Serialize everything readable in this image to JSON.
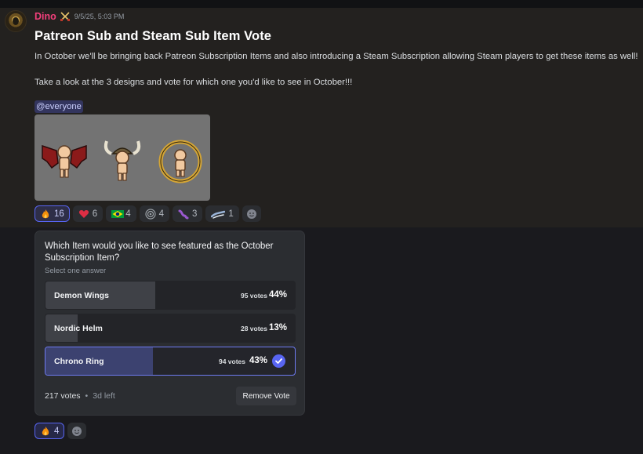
{
  "message": {
    "username": "Dino",
    "username_color": "#f23f7b",
    "role_icon": "crossed-swords-icon",
    "timestamp": "9/5/25, 5:03 PM",
    "title": "Patreon Sub and Steam Sub Item Vote",
    "paragraph1": "In October we'll be bringing back Patreon Subscription Items and also introducing a Steam Subscription allowing Steam players to get these items as well!",
    "paragraph2": "Take a look at the 3 designs and vote for which one you'd like to see in October!!!",
    "mention": "@everyone",
    "attachment_sprites": [
      "demon-wings-sprite",
      "nordic-helm-sprite",
      "chrono-ring-sprite"
    ]
  },
  "reactions": [
    {
      "icon": "fire-emoji",
      "count": "16",
      "me": true
    },
    {
      "icon": "red-heart-emoji",
      "count": "6",
      "me": false
    },
    {
      "icon": "brazil-flag-emoji",
      "count": "4",
      "me": false
    },
    {
      "icon": "target-emoji",
      "count": "4",
      "me": false
    },
    {
      "icon": "purple-worm-emoji",
      "count": "3",
      "me": false
    },
    {
      "icon": "wave-emoji",
      "count": "1",
      "me": false
    }
  ],
  "poll": {
    "question": "Which Item would you like to see featured as the October Subscription Item?",
    "hint": "Select one answer",
    "answers": [
      {
        "label": "Demon Wings",
        "votes": "95 votes",
        "percent": "44%",
        "fraction": 0.44,
        "voted": false
      },
      {
        "label": "Nordic Helm",
        "votes": "28 votes",
        "percent": "13%",
        "fraction": 0.13,
        "voted": false
      },
      {
        "label": "Chrono Ring",
        "votes": "94 votes",
        "percent": "43%",
        "fraction": 0.43,
        "voted": true
      }
    ],
    "total_votes": "217 votes",
    "time_left": "3d left",
    "remove_vote_label": "Remove Vote"
  },
  "poll_reactions": [
    {
      "icon": "fire-emoji",
      "count": "4",
      "me": true
    }
  ],
  "colors": {
    "accent": "#5865f2",
    "background": "#1a1a1e"
  }
}
